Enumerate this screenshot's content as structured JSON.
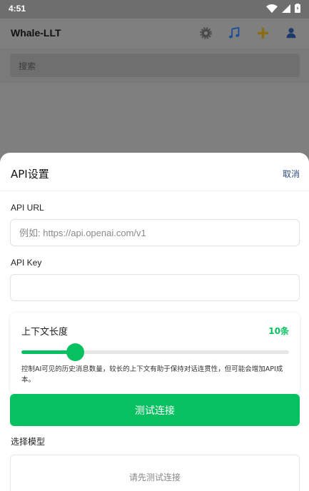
{
  "status_bar": {
    "time": "4:51"
  },
  "app_bar": {
    "title": "Whale-LLT",
    "icons": [
      "gear-icon",
      "music-note-icon",
      "plus-icon",
      "user-icon"
    ]
  },
  "search": {
    "placeholder": "搜索"
  },
  "sheet": {
    "title": "API设置",
    "cancel_label": "取消",
    "api_url": {
      "label": "API URL",
      "placeholder": "例如: https://api.openai.com/v1",
      "value": ""
    },
    "api_key": {
      "label": "API Key",
      "value": ""
    },
    "context": {
      "label": "上下文长度",
      "value_text": "10条",
      "slider_fraction": 0.2,
      "description": "控制AI可见的历史消息数量，较长的上下文有助于保持对话连贯性，但可能会增加API成本。"
    },
    "test_button_label": "测试连接",
    "model": {
      "label": "选择模型",
      "placeholder": "请先测试连接"
    }
  },
  "colors": {
    "accent": "#07c160",
    "cancel": "#2b4c7e",
    "overlay": "#7f7f7f"
  }
}
